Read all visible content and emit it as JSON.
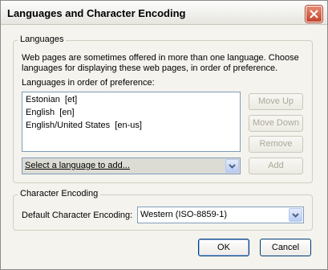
{
  "window": {
    "title": "Languages and Character Encoding"
  },
  "languages": {
    "legend": "Languages",
    "description": "Web pages are sometimes offered in more than one language. Choose languages for displaying these web pages, in order of preference.",
    "order_label": "Languages in order of preference:",
    "items": [
      {
        "label": "Estonian  [et]"
      },
      {
        "label": "English  [en]"
      },
      {
        "label": "English/United States  [en-us]"
      }
    ],
    "buttons": {
      "move_up": "Move Up",
      "move_down": "Move Down",
      "remove": "Remove",
      "add": "Add"
    },
    "add_select_value": "Select a language to add..."
  },
  "encoding": {
    "legend": "Character Encoding",
    "label": "Default Character Encoding:",
    "value": "Western (ISO-8859-1)"
  },
  "footer": {
    "ok": "OK",
    "cancel": "Cancel"
  },
  "icons": {
    "close": "close-icon",
    "dropdown": "chevron-down-icon"
  },
  "colors": {
    "close_button": "#c1452a",
    "list_border": "#7f9db9",
    "disabled_text": "#aca899"
  }
}
